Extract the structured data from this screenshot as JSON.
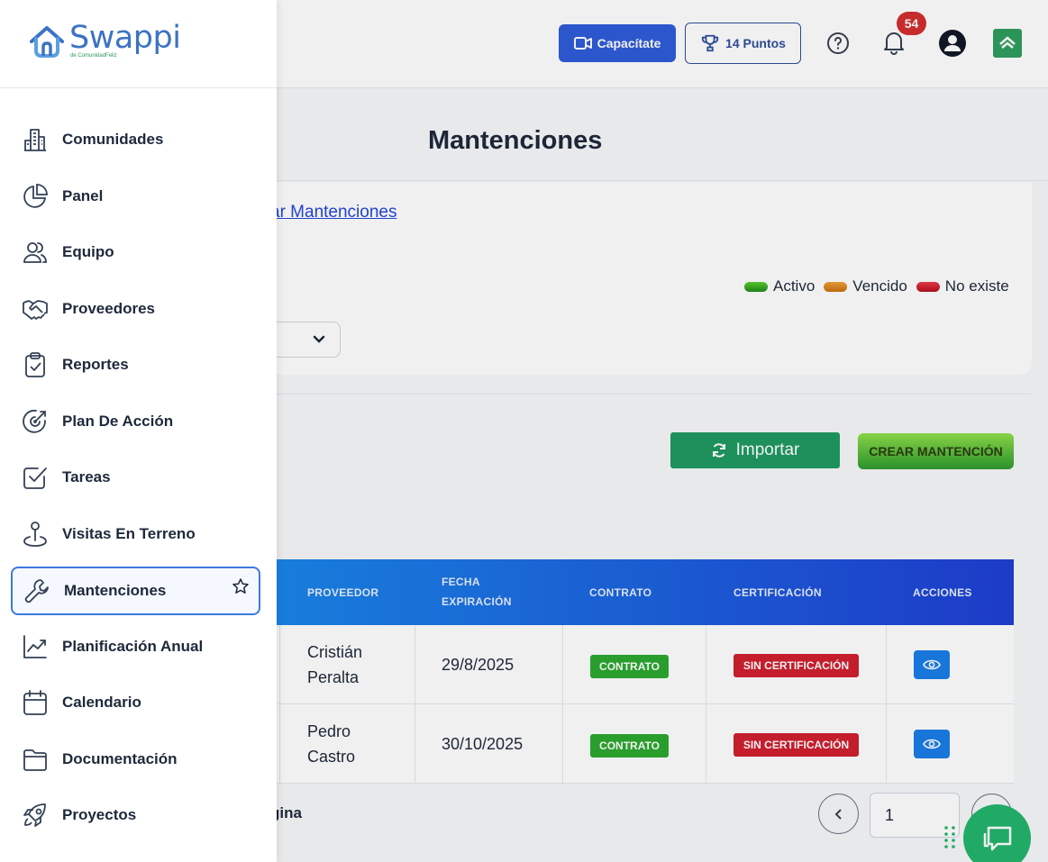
{
  "header": {
    "capacitate_label": "Capacítate",
    "puntos_label": "14 Puntos",
    "notifications_count": "54"
  },
  "main": {
    "title": "Mantenciones",
    "link_text": "ar Mantenciones",
    "legend": [
      {
        "label": "Activo",
        "color": "#2e9b2e"
      },
      {
        "label": "Vencido",
        "color": "#e08a1f"
      },
      {
        "label": "No existe",
        "color": "#d11f2f"
      }
    ],
    "import_label": "Importar",
    "create_label": "CREAR MANTENCIÓN"
  },
  "table": {
    "headers": {
      "proveedor": "PROVEEDOR",
      "fecha_line1": "FECHA",
      "fecha_line2": "EXPIRACIÓN",
      "contrato": "CONTRATO",
      "certificacion": "CERTIFICACIÓN",
      "acciones": "ACCIONES"
    },
    "rows": [
      {
        "proveedor_first": "Cristián",
        "proveedor_last": "Peralta",
        "fecha": "29/8/2025",
        "contrato": "CONTRATO",
        "certificacion": "SIN CERTIFICACIÓN"
      },
      {
        "proveedor_first": "Pedro",
        "proveedor_last": "Castro",
        "fecha": "30/10/2025",
        "contrato": "CONTRATO",
        "certificacion": "SIN CERTIFICACIÓN"
      }
    ]
  },
  "pagination": {
    "text": "gina",
    "page_value": "1"
  },
  "sidebar": {
    "brand": "Swappi",
    "brand_sub": "de ComunidadFeliz",
    "items": [
      {
        "label": "Comunidades",
        "icon": "building-icon"
      },
      {
        "label": "Panel",
        "icon": "pie-chart-icon"
      },
      {
        "label": "Equipo",
        "icon": "users-icon"
      },
      {
        "label": "Proveedores",
        "icon": "handshake-icon"
      },
      {
        "label": "Reportes",
        "icon": "clipboard-check-icon"
      },
      {
        "label": "Plan De Acción",
        "icon": "target-icon"
      },
      {
        "label": "Tareas",
        "icon": "checkbox-icon"
      },
      {
        "label": "Visitas En Terreno",
        "icon": "map-pin-icon"
      },
      {
        "label": "Mantenciones",
        "icon": "wrench-icon",
        "active": true
      },
      {
        "label": "Planificación Anual",
        "icon": "trend-icon"
      },
      {
        "label": "Calendario",
        "icon": "calendar-icon"
      },
      {
        "label": "Documentación",
        "icon": "folder-icon"
      },
      {
        "label": "Proyectos",
        "icon": "rocket-icon"
      }
    ]
  }
}
